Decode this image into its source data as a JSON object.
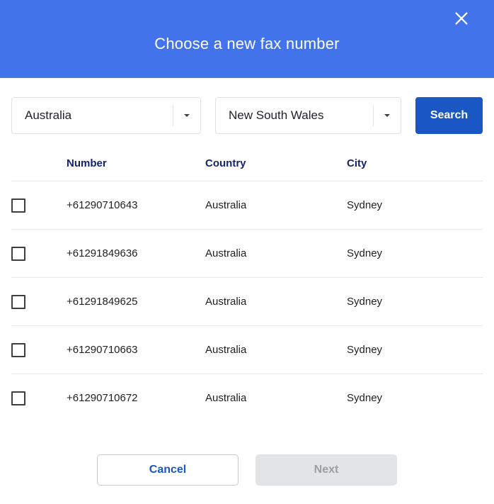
{
  "dialog": {
    "title": "Choose a new fax number",
    "close_icon": "close-icon"
  },
  "search": {
    "country_select": {
      "value": "Australia",
      "caret_icon": "chevron-down-icon"
    },
    "region_select": {
      "value": "New South Wales",
      "caret_icon": "chevron-down-icon"
    },
    "search_label": "Search"
  },
  "table": {
    "columns": {
      "select": "",
      "number": "Number",
      "country": "Country",
      "city": "City"
    },
    "rows": [
      {
        "checked": false,
        "number": "+61290710643",
        "country": "Australia",
        "city": "Sydney"
      },
      {
        "checked": false,
        "number": "+61291849636",
        "country": "Australia",
        "city": "Sydney"
      },
      {
        "checked": false,
        "number": "+61291849625",
        "country": "Australia",
        "city": "Sydney"
      },
      {
        "checked": false,
        "number": "+61290710663",
        "country": "Australia",
        "city": "Sydney"
      },
      {
        "checked": false,
        "number": "+61290710672",
        "country": "Australia",
        "city": "Sydney"
      }
    ]
  },
  "footer": {
    "cancel_label": "Cancel",
    "next_label": "Next"
  },
  "colors": {
    "header_blue": "#4273ea",
    "action_blue": "#1a56c4",
    "header_text_navy": "#16226b",
    "disabled_gray_bg": "#e3e4e6",
    "disabled_gray_text": "#9aa0a6"
  }
}
